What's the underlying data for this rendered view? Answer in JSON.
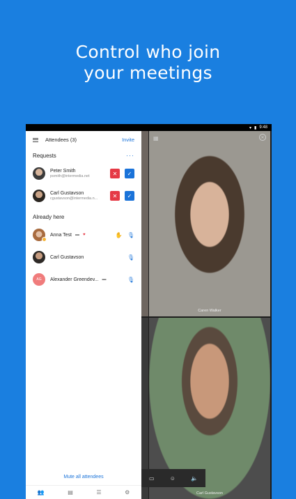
{
  "headline": {
    "line1": "Control who join",
    "line2": "your meetings"
  },
  "status": {
    "time": "9:48"
  },
  "panel": {
    "title": "Attendees (3)",
    "invite_label": "Invite",
    "requests_title": "Requests",
    "more": "···",
    "requests": [
      {
        "name": "Peter Smith",
        "email": "psmith@intermedia.net"
      },
      {
        "name": "Carl Gustavson",
        "email": "cgustavson@intermedia.n..."
      }
    ],
    "already_title": "Already here",
    "attendees": [
      {
        "name": "Anna Test"
      },
      {
        "name": "Carl Gustavson"
      },
      {
        "name": "Alexander Greendev...",
        "initials": "AG"
      }
    ],
    "mute_all": "Mute all attendees"
  },
  "videos": [
    {
      "name": "Caren Walker"
    },
    {
      "name": "Carl Gustavson"
    }
  ],
  "icons": {
    "menu": "menu-icon",
    "deny": "x-icon",
    "accept": "check-icon",
    "mic": "mic-icon",
    "hand": "raise-hand-icon",
    "screen": "screen-icon",
    "emoji": "emoji-icon",
    "volume": "volume-icon",
    "grid": "grid-icon",
    "close": "close-icon"
  },
  "colors": {
    "brand": "#1a7fe0",
    "accent": "#1a73d9",
    "deny": "#e53945"
  }
}
